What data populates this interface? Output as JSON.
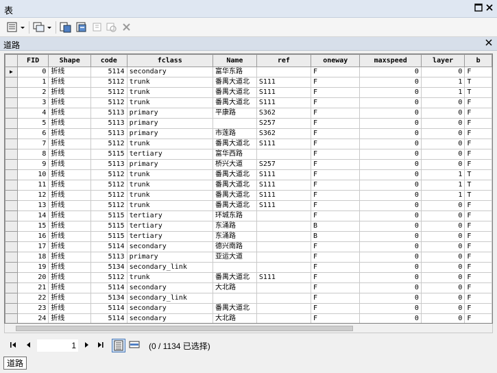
{
  "window": {
    "title": "表",
    "controls": [
      "restore-icon",
      "close-icon"
    ]
  },
  "toolbar": {
    "icons": [
      "table-options-icon",
      "related-tables-icon",
      "select-by-attributes-icon",
      "switch-selection-icon",
      "clear-selection-icon",
      "zoom-to-selected-icon",
      "delete-selected-icon"
    ]
  },
  "subtab": {
    "name": "道路"
  },
  "grid": {
    "columns": [
      "FID",
      "Shape",
      "code",
      "fclass",
      "Name",
      "ref",
      "oneway",
      "maxspeed",
      "layer",
      "b"
    ],
    "rows": [
      [
        "0",
        "折线",
        "5114",
        "secondary",
        "富华东路",
        "",
        "F",
        "0",
        "0",
        "F"
      ],
      [
        "1",
        "折线",
        "5112",
        "trunk",
        "番禺大道北",
        "S111",
        "F",
        "0",
        "1",
        "T"
      ],
      [
        "2",
        "折线",
        "5112",
        "trunk",
        "番禺大道北",
        "S111",
        "F",
        "0",
        "1",
        "T"
      ],
      [
        "3",
        "折线",
        "5112",
        "trunk",
        "番禺大道北",
        "S111",
        "F",
        "0",
        "0",
        "F"
      ],
      [
        "4",
        "折线",
        "5113",
        "primary",
        "平康路",
        "S362",
        "F",
        "0",
        "0",
        "F"
      ],
      [
        "5",
        "折线",
        "5113",
        "primary",
        "",
        "S257",
        "F",
        "0",
        "0",
        "F"
      ],
      [
        "6",
        "折线",
        "5113",
        "primary",
        "市莲路",
        "S362",
        "F",
        "0",
        "0",
        "F"
      ],
      [
        "7",
        "折线",
        "5112",
        "trunk",
        "番禺大道北",
        "S111",
        "F",
        "0",
        "0",
        "F"
      ],
      [
        "8",
        "折线",
        "5115",
        "tertiary",
        "富华西路",
        "",
        "F",
        "0",
        "0",
        "F"
      ],
      [
        "9",
        "折线",
        "5113",
        "primary",
        "桥兴大道",
        "S257",
        "F",
        "0",
        "0",
        "F"
      ],
      [
        "10",
        "折线",
        "5112",
        "trunk",
        "番禺大道北",
        "S111",
        "F",
        "0",
        "1",
        "T"
      ],
      [
        "11",
        "折线",
        "5112",
        "trunk",
        "番禺大道北",
        "S111",
        "F",
        "0",
        "1",
        "T"
      ],
      [
        "12",
        "折线",
        "5112",
        "trunk",
        "番禺大道北",
        "S111",
        "F",
        "0",
        "1",
        "T"
      ],
      [
        "13",
        "折线",
        "5112",
        "trunk",
        "番禺大道北",
        "S111",
        "F",
        "0",
        "0",
        "F"
      ],
      [
        "14",
        "折线",
        "5115",
        "tertiary",
        "环城东路",
        "",
        "F",
        "0",
        "0",
        "F"
      ],
      [
        "15",
        "折线",
        "5115",
        "tertiary",
        "东涌路",
        "",
        "B",
        "0",
        "0",
        "F"
      ],
      [
        "16",
        "折线",
        "5115",
        "tertiary",
        "东涌路",
        "",
        "B",
        "0",
        "0",
        "F"
      ],
      [
        "17",
        "折线",
        "5114",
        "secondary",
        "德兴南路",
        "",
        "F",
        "0",
        "0",
        "F"
      ],
      [
        "18",
        "折线",
        "5113",
        "primary",
        "亚运大道",
        "",
        "F",
        "0",
        "0",
        "F"
      ],
      [
        "19",
        "折线",
        "5134",
        "secondary_link",
        "",
        "",
        "F",
        "0",
        "0",
        "F"
      ],
      [
        "20",
        "折线",
        "5112",
        "trunk",
        "番禺大道北",
        "S111",
        "F",
        "0",
        "0",
        "F"
      ],
      [
        "21",
        "折线",
        "5114",
        "secondary",
        "大北路",
        "",
        "F",
        "0",
        "0",
        "F"
      ],
      [
        "22",
        "折线",
        "5134",
        "secondary_link",
        "",
        "",
        "F",
        "0",
        "0",
        "F"
      ],
      [
        "23",
        "折线",
        "5114",
        "secondary",
        "番禺大道北",
        "",
        "F",
        "0",
        "0",
        "F"
      ],
      [
        "24",
        "折线",
        "5114",
        "secondary",
        "大北路",
        "",
        "F",
        "0",
        "0",
        "F"
      ]
    ]
  },
  "navigation": {
    "current_record": "1",
    "status": "(0 / 1134 已选择)",
    "icons": [
      "first-record-icon",
      "prev-record-icon",
      "next-record-icon",
      "last-record-icon",
      "show-all-records-icon",
      "show-selected-records-icon"
    ]
  },
  "bottom_tab": {
    "label": "道路"
  },
  "colors": {
    "titlebar": "#dfe7f2",
    "subtab": "#d7dfea",
    "header_bg": "#ececec"
  }
}
